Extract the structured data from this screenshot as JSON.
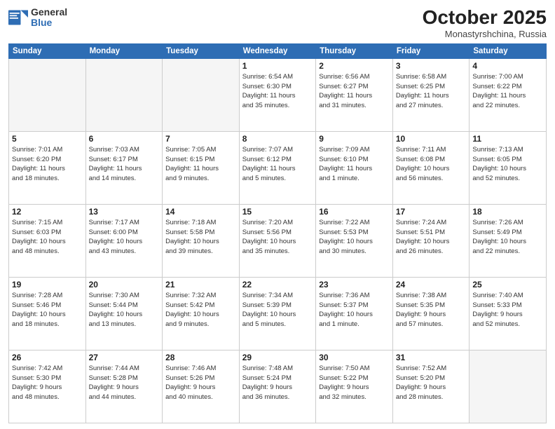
{
  "header": {
    "logo_general": "General",
    "logo_blue": "Blue",
    "month": "October 2025",
    "location": "Monastyrshchina, Russia"
  },
  "days_of_week": [
    "Sunday",
    "Monday",
    "Tuesday",
    "Wednesday",
    "Thursday",
    "Friday",
    "Saturday"
  ],
  "weeks": [
    [
      {
        "num": "",
        "info": ""
      },
      {
        "num": "",
        "info": ""
      },
      {
        "num": "",
        "info": ""
      },
      {
        "num": "1",
        "info": "Sunrise: 6:54 AM\nSunset: 6:30 PM\nDaylight: 11 hours\nand 35 minutes."
      },
      {
        "num": "2",
        "info": "Sunrise: 6:56 AM\nSunset: 6:27 PM\nDaylight: 11 hours\nand 31 minutes."
      },
      {
        "num": "3",
        "info": "Sunrise: 6:58 AM\nSunset: 6:25 PM\nDaylight: 11 hours\nand 27 minutes."
      },
      {
        "num": "4",
        "info": "Sunrise: 7:00 AM\nSunset: 6:22 PM\nDaylight: 11 hours\nand 22 minutes."
      }
    ],
    [
      {
        "num": "5",
        "info": "Sunrise: 7:01 AM\nSunset: 6:20 PM\nDaylight: 11 hours\nand 18 minutes."
      },
      {
        "num": "6",
        "info": "Sunrise: 7:03 AM\nSunset: 6:17 PM\nDaylight: 11 hours\nand 14 minutes."
      },
      {
        "num": "7",
        "info": "Sunrise: 7:05 AM\nSunset: 6:15 PM\nDaylight: 11 hours\nand 9 minutes."
      },
      {
        "num": "8",
        "info": "Sunrise: 7:07 AM\nSunset: 6:12 PM\nDaylight: 11 hours\nand 5 minutes."
      },
      {
        "num": "9",
        "info": "Sunrise: 7:09 AM\nSunset: 6:10 PM\nDaylight: 11 hours\nand 1 minute."
      },
      {
        "num": "10",
        "info": "Sunrise: 7:11 AM\nSunset: 6:08 PM\nDaylight: 10 hours\nand 56 minutes."
      },
      {
        "num": "11",
        "info": "Sunrise: 7:13 AM\nSunset: 6:05 PM\nDaylight: 10 hours\nand 52 minutes."
      }
    ],
    [
      {
        "num": "12",
        "info": "Sunrise: 7:15 AM\nSunset: 6:03 PM\nDaylight: 10 hours\nand 48 minutes."
      },
      {
        "num": "13",
        "info": "Sunrise: 7:17 AM\nSunset: 6:00 PM\nDaylight: 10 hours\nand 43 minutes."
      },
      {
        "num": "14",
        "info": "Sunrise: 7:18 AM\nSunset: 5:58 PM\nDaylight: 10 hours\nand 39 minutes."
      },
      {
        "num": "15",
        "info": "Sunrise: 7:20 AM\nSunset: 5:56 PM\nDaylight: 10 hours\nand 35 minutes."
      },
      {
        "num": "16",
        "info": "Sunrise: 7:22 AM\nSunset: 5:53 PM\nDaylight: 10 hours\nand 30 minutes."
      },
      {
        "num": "17",
        "info": "Sunrise: 7:24 AM\nSunset: 5:51 PM\nDaylight: 10 hours\nand 26 minutes."
      },
      {
        "num": "18",
        "info": "Sunrise: 7:26 AM\nSunset: 5:49 PM\nDaylight: 10 hours\nand 22 minutes."
      }
    ],
    [
      {
        "num": "19",
        "info": "Sunrise: 7:28 AM\nSunset: 5:46 PM\nDaylight: 10 hours\nand 18 minutes."
      },
      {
        "num": "20",
        "info": "Sunrise: 7:30 AM\nSunset: 5:44 PM\nDaylight: 10 hours\nand 13 minutes."
      },
      {
        "num": "21",
        "info": "Sunrise: 7:32 AM\nSunset: 5:42 PM\nDaylight: 10 hours\nand 9 minutes."
      },
      {
        "num": "22",
        "info": "Sunrise: 7:34 AM\nSunset: 5:39 PM\nDaylight: 10 hours\nand 5 minutes."
      },
      {
        "num": "23",
        "info": "Sunrise: 7:36 AM\nSunset: 5:37 PM\nDaylight: 10 hours\nand 1 minute."
      },
      {
        "num": "24",
        "info": "Sunrise: 7:38 AM\nSunset: 5:35 PM\nDaylight: 9 hours\nand 57 minutes."
      },
      {
        "num": "25",
        "info": "Sunrise: 7:40 AM\nSunset: 5:33 PM\nDaylight: 9 hours\nand 52 minutes."
      }
    ],
    [
      {
        "num": "26",
        "info": "Sunrise: 7:42 AM\nSunset: 5:30 PM\nDaylight: 9 hours\nand 48 minutes."
      },
      {
        "num": "27",
        "info": "Sunrise: 7:44 AM\nSunset: 5:28 PM\nDaylight: 9 hours\nand 44 minutes."
      },
      {
        "num": "28",
        "info": "Sunrise: 7:46 AM\nSunset: 5:26 PM\nDaylight: 9 hours\nand 40 minutes."
      },
      {
        "num": "29",
        "info": "Sunrise: 7:48 AM\nSunset: 5:24 PM\nDaylight: 9 hours\nand 36 minutes."
      },
      {
        "num": "30",
        "info": "Sunrise: 7:50 AM\nSunset: 5:22 PM\nDaylight: 9 hours\nand 32 minutes."
      },
      {
        "num": "31",
        "info": "Sunrise: 7:52 AM\nSunset: 5:20 PM\nDaylight: 9 hours\nand 28 minutes."
      },
      {
        "num": "",
        "info": ""
      }
    ]
  ]
}
